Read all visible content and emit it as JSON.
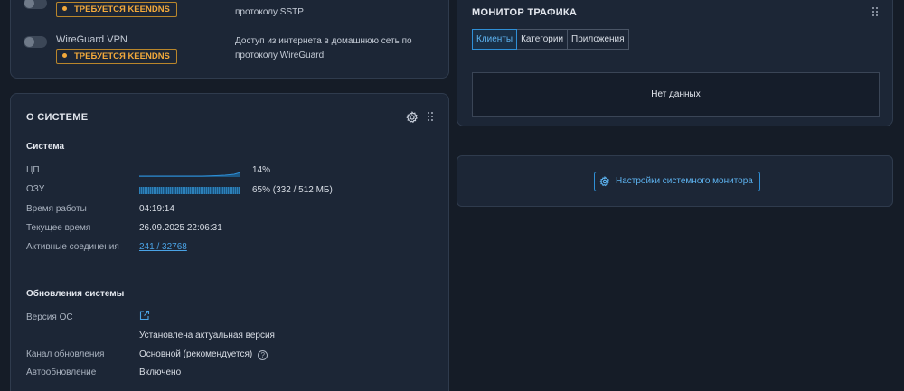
{
  "vpn": {
    "items": [
      {
        "name": "",
        "badge": "ТРЕБУЕТСЯ KEENDNS",
        "description": "протоколу SSTP"
      },
      {
        "name": "WireGuard VPN",
        "badge": "ТРЕБУЕТСЯ KEENDNS",
        "description": "Доступ из интернета в домашнюю сеть по протоколу WireGuard"
      }
    ]
  },
  "system": {
    "title": "О СИСТЕМЕ",
    "section_system": "Система",
    "cpu_label": "ЦП",
    "cpu_value": "14%",
    "ram_label": "ОЗУ",
    "ram_value": "65% (332 / 512 МБ)",
    "ram_fraction": 0.65,
    "uptime_label": "Время работы",
    "uptime_value": "04:19:14",
    "time_label": "Текущее время",
    "time_value": "26.09.2025 22:06:31",
    "connections_label": "Активные соединения",
    "connections_value": "241 / 32768",
    "section_updates": "Обновления системы",
    "os_label": "Версия ОС",
    "os_status": "Установлена актуальная версия",
    "channel_label": "Канал обновления",
    "channel_value": "Основной (рекомендуется)",
    "auto_label": "Автообновление",
    "auto_value": "Включено"
  },
  "traffic": {
    "title": "МОНИТОР ТРАФИКА",
    "tabs": [
      "Клиенты",
      "Категории",
      "Приложения"
    ],
    "active_tab": "Клиенты",
    "empty": "Нет данных"
  },
  "monitor": {
    "button_label": "Настройки системного монитора"
  },
  "colors": {
    "background": "#151c27",
    "card": "#1c2636",
    "accent": "#2f8fd6",
    "badge": "#f2a93b"
  }
}
